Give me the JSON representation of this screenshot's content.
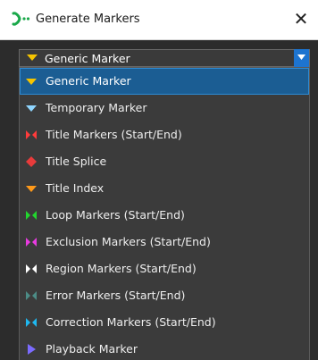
{
  "window": {
    "title": "Generate Markers",
    "close_glyph": "✕"
  },
  "combo": {
    "selected": "Generic Marker",
    "icon": "generic-marker-icon"
  },
  "dropdown": {
    "items": [
      {
        "label": "Generic Marker",
        "icon": "generic-marker-icon",
        "color": "#f5c400"
      },
      {
        "label": "Temporary Marker",
        "icon": "temporary-marker-icon",
        "color": "#8fd6ff"
      },
      {
        "label": "Title Markers (Start/End)",
        "icon": "title-markers-icon",
        "color": "#ff3b3b"
      },
      {
        "label": "Title Splice",
        "icon": "title-splice-icon",
        "color": "#e83b3b"
      },
      {
        "label": "Title Index",
        "icon": "title-index-icon",
        "color": "#ff9a1a"
      },
      {
        "label": "Loop Markers (Start/End)",
        "icon": "loop-markers-icon",
        "color": "#22d62e"
      },
      {
        "label": "Exclusion Markers (Start/End)",
        "icon": "exclusion-markers-icon",
        "color": "#e83be0"
      },
      {
        "label": "Region Markers (Start/End)",
        "icon": "region-markers-icon",
        "color": "#ffffff"
      },
      {
        "label": "Error Markers (Start/End)",
        "icon": "error-markers-icon",
        "color": "#4c8c86"
      },
      {
        "label": "Correction Markers (Start/End)",
        "icon": "correction-markers-icon",
        "color": "#1fb8f0"
      },
      {
        "label": "Playback Marker",
        "icon": "playback-marker-icon",
        "color": "#7b6bff"
      }
    ],
    "selected_index": 0
  },
  "colors": {
    "accent": "#1d74d0",
    "selection_bg": "#1b5d93",
    "dropdown_bg": "#3b3b3b"
  }
}
